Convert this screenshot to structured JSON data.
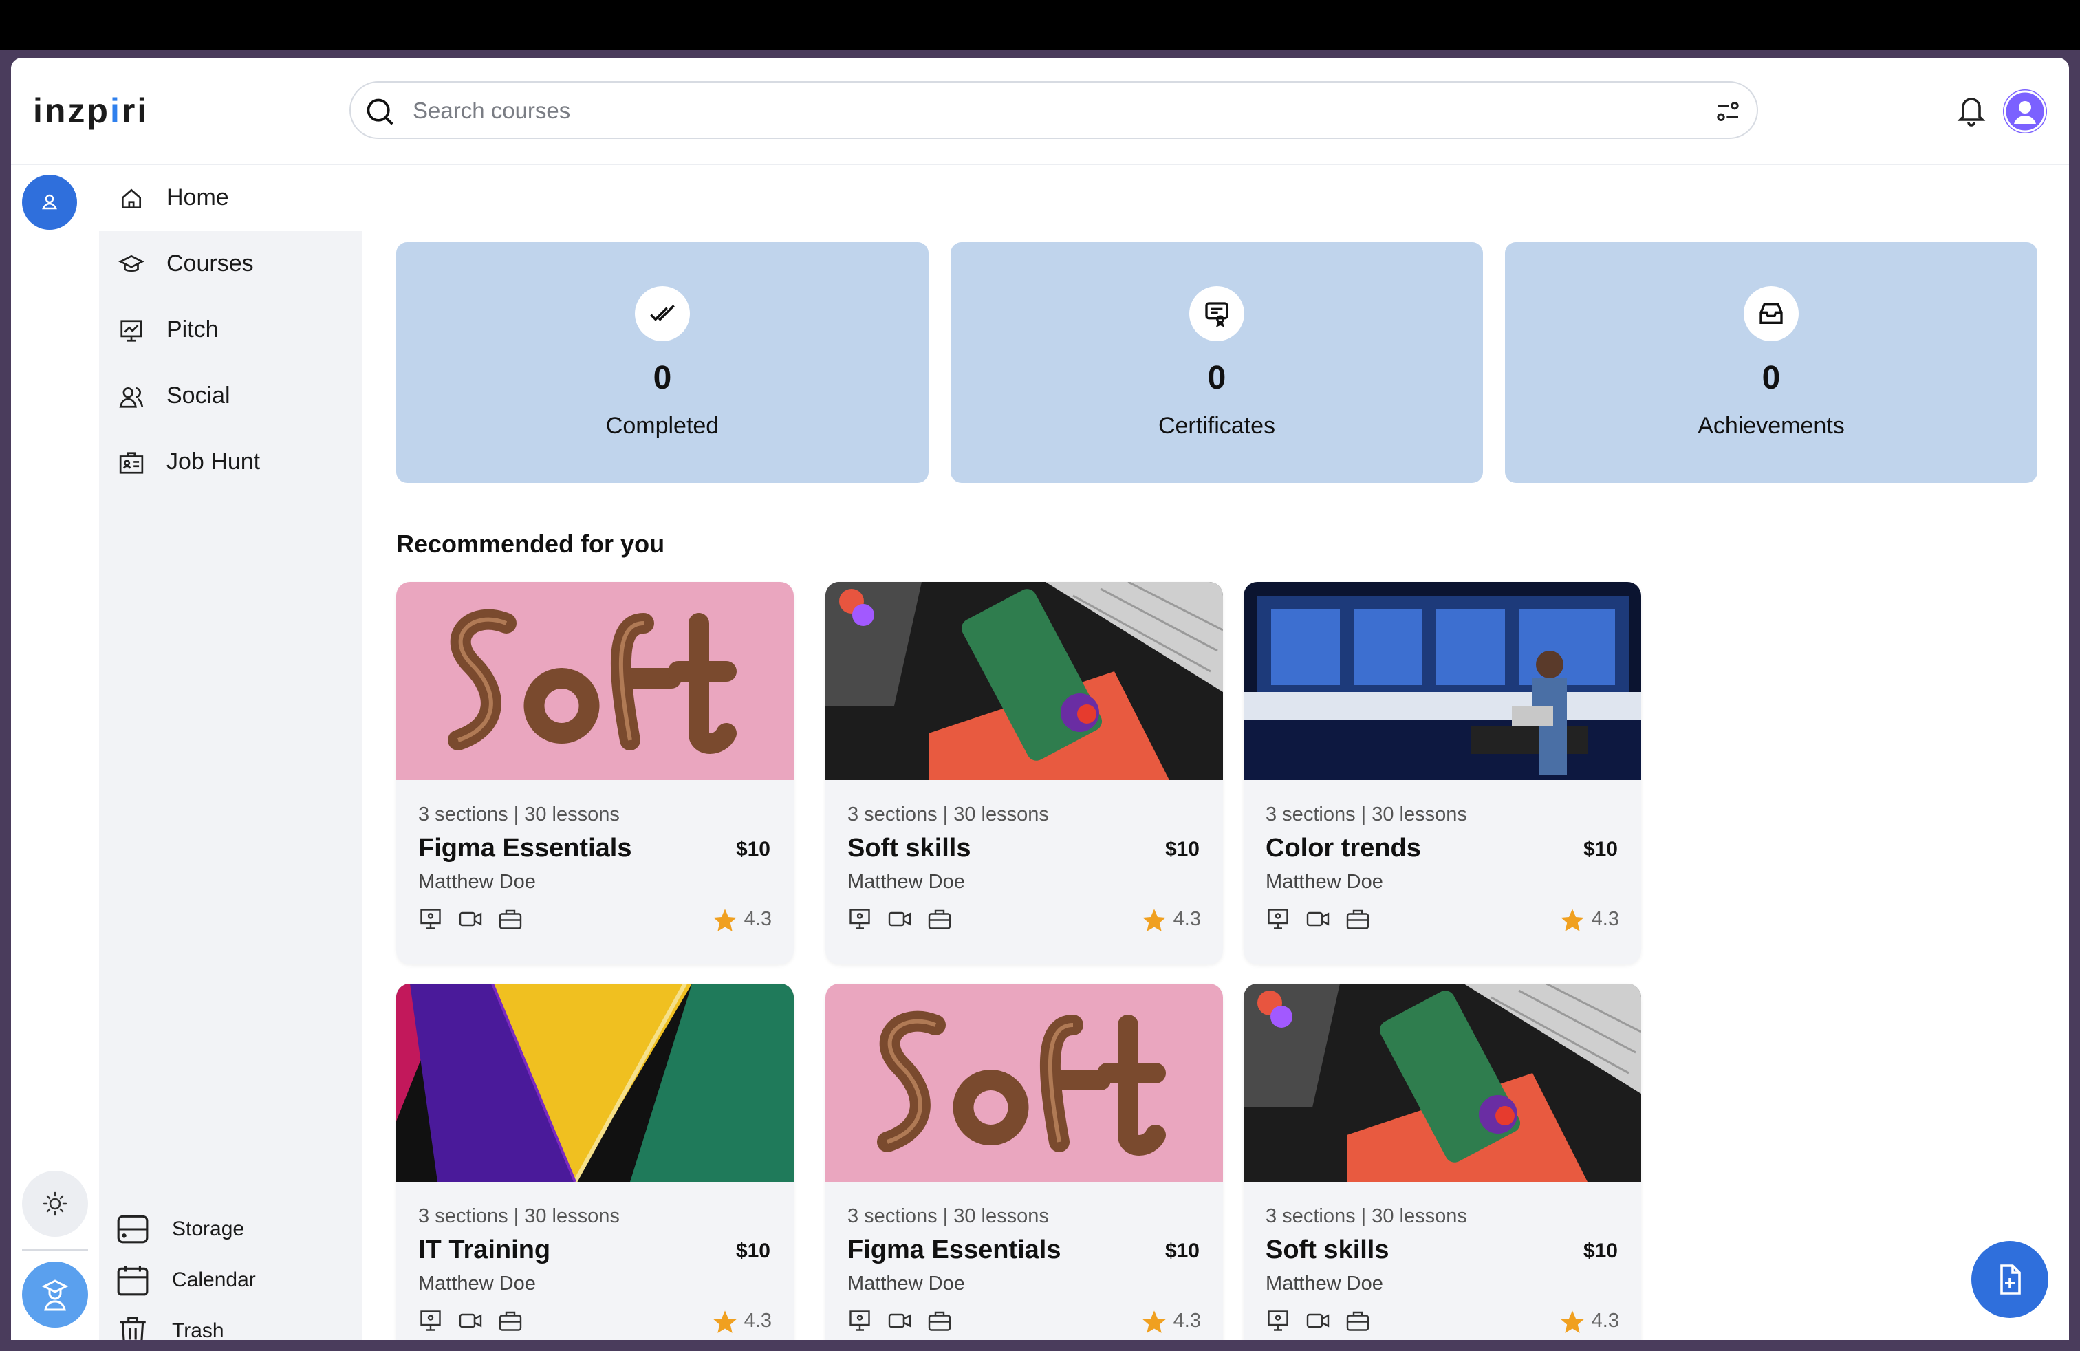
{
  "app": {
    "logo_text_a": "inzp",
    "logo_text_dot": "i",
    "logo_text_b": "ri"
  },
  "search": {
    "placeholder": "Search courses",
    "value": ""
  },
  "sidebar": {
    "items": [
      {
        "label": "Home",
        "icon": "home-icon",
        "active": true
      },
      {
        "label": "Courses",
        "icon": "graduation-cap-icon"
      },
      {
        "label": "Pitch",
        "icon": "presentation-chart-icon"
      },
      {
        "label": "Social",
        "icon": "users-icon"
      },
      {
        "label": "Job Hunt",
        "icon": "id-card-icon"
      }
    ],
    "bottom": [
      {
        "label": "Storage",
        "icon": "storage-icon"
      },
      {
        "label": "Calendar",
        "icon": "calendar-icon"
      },
      {
        "label": "Trash",
        "icon": "trash-icon"
      }
    ]
  },
  "stats": [
    {
      "value": "0",
      "label": "Completed",
      "icon": "double-check-icon"
    },
    {
      "value": "0",
      "label": "Certificates",
      "icon": "certificate-icon"
    },
    {
      "value": "0",
      "label": "Achievements",
      "icon": "inbox-icon"
    }
  ],
  "recommended": {
    "title": "Recommended for you",
    "courses": [
      {
        "meta": "3 sections | 30 lessons",
        "title": "Figma Essentials",
        "price": "$10",
        "author": "Matthew Doe",
        "rating": "4.3",
        "thumb": "soft-3d"
      },
      {
        "meta": "3 sections | 30 lessons",
        "title": "Soft skills",
        "price": "$10",
        "author": "Matthew Doe",
        "rating": "4.3",
        "thumb": "desk-phone"
      },
      {
        "meta": "3 sections | 30 lessons",
        "title": "Color trends",
        "price": "$10",
        "author": "Matthew Doe",
        "rating": "4.3",
        "thumb": "server-room"
      },
      {
        "meta": "3 sections | 30 lessons",
        "title": "IT Training",
        "price": "$10",
        "author": "Matthew Doe",
        "rating": "4.3",
        "thumb": "color-stripes"
      },
      {
        "meta": "3 sections | 30 lessons",
        "title": "Figma Essentials",
        "price": "$10",
        "author": "Matthew Doe",
        "rating": "4.3",
        "thumb": "soft-3d"
      },
      {
        "meta": "3 sections | 30 lessons",
        "title": "Soft skills",
        "price": "$10",
        "author": "Matthew Doe",
        "rating": "4.3",
        "thumb": "desk-phone"
      }
    ]
  },
  "colors": {
    "accent": "#2f6fdc",
    "stat_bg": "#c0d4ec",
    "star": "#f0a020",
    "sidebar_bg": "#f2f3f6"
  }
}
